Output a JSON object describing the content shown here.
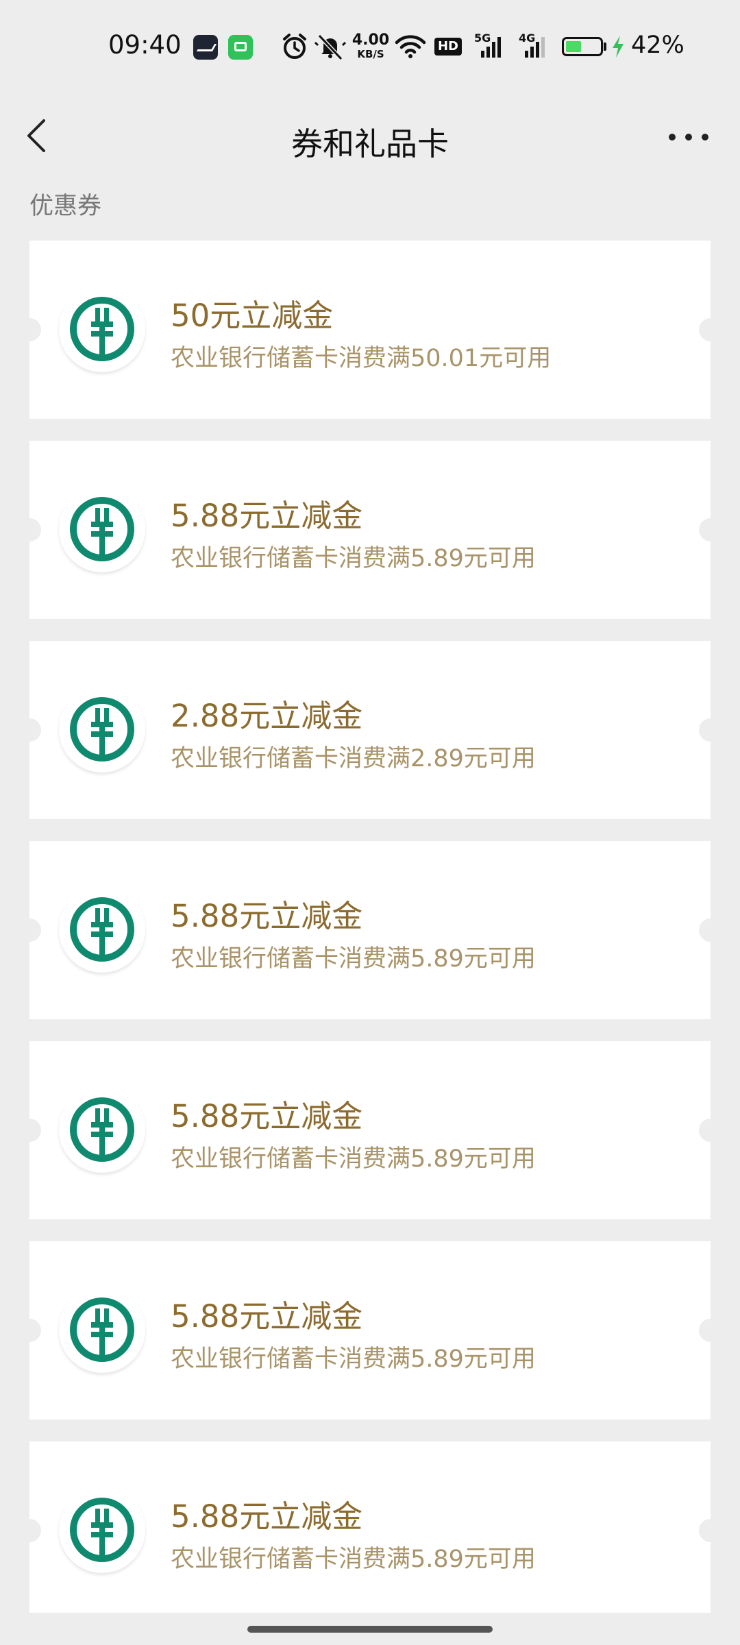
{
  "status_bar": {
    "time": "09:40",
    "net_speed_value": "4.00",
    "net_speed_unit": "KB/S",
    "hd_badge": "HD",
    "net_5g": "5G",
    "net_4g": "4G",
    "battery_level": 0.42,
    "battery_percent": "42%",
    "icons": [
      "mail-icon",
      "message-icon",
      "alarm-icon",
      "mute-icon",
      "wifi-icon",
      "signal-5g-icon",
      "signal-4g-icon",
      "battery-icon",
      "charging-icon"
    ]
  },
  "nav": {
    "title": "券和礼品卡",
    "back_icon": "chevron-left-icon",
    "more_icon": "more-icon"
  },
  "section": {
    "label": "优惠券"
  },
  "coupons": [
    {
      "title": "50元立减金",
      "desc": "农业银行储蓄卡消费满50.01元可用"
    },
    {
      "title": "5.88元立减金",
      "desc": "农业银行储蓄卡消费满5.89元可用"
    },
    {
      "title": "2.88元立减金",
      "desc": "农业银行储蓄卡消费满2.89元可用"
    },
    {
      "title": "5.88元立减金",
      "desc": "农业银行储蓄卡消费满5.89元可用"
    },
    {
      "title": "5.88元立减金",
      "desc": "农业银行储蓄卡消费满5.89元可用"
    },
    {
      "title": "5.88元立减金",
      "desc": "农业银行储蓄卡消费满5.89元可用"
    },
    {
      "title": "5.88元立减金",
      "desc": "农业银行储蓄卡消费满5.89元可用"
    }
  ],
  "colors": {
    "background": "#ededed",
    "card": "#ffffff",
    "coupon_title": "#8c6b2f",
    "coupon_desc": "#a99469",
    "bank_logo": "#0f8a6f",
    "battery_fill": "#4cd964",
    "charging": "#2fc25b"
  }
}
